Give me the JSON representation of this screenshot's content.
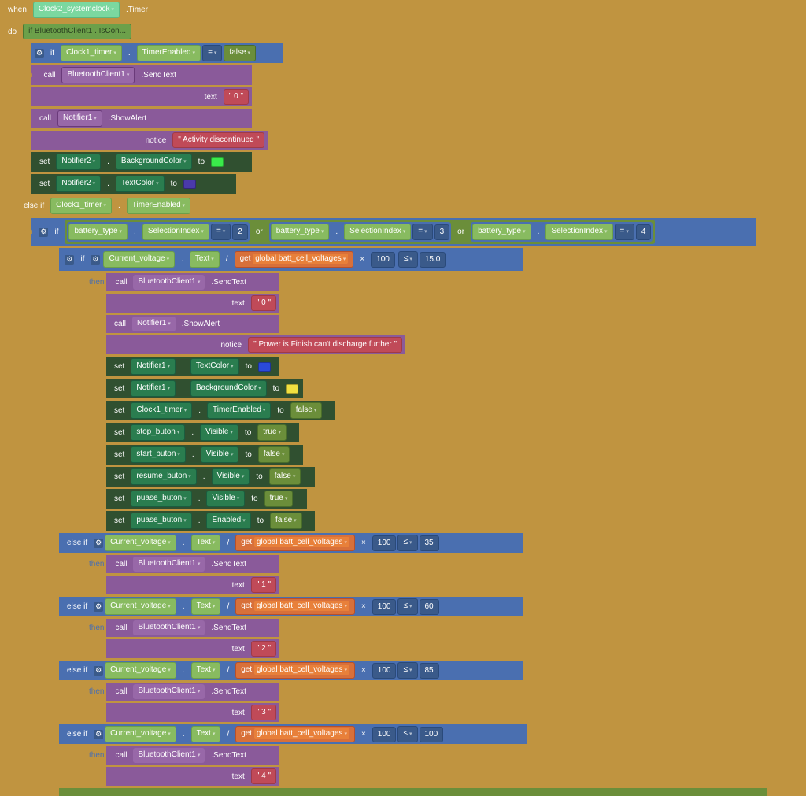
{
  "header": {
    "when": "when",
    "clock": "Clock2_systemclock",
    "timer": ".Timer"
  },
  "do": "do",
  "if_label": "if",
  "then_label": "then",
  "elseif_label": "else if",
  "cond_bt": "if BluetoothClient1 . IsCon...",
  "clock1_timer": "Clock1_timer",
  "timer_enabled": "TimerEnabled",
  "eq": "=",
  "false": "false",
  "true": "true",
  "call": "call",
  "bt_client": "BluetoothClient1",
  "send_text": ".SendText",
  "text_lbl": "text",
  "val_0": " 0 ",
  "val_1": " 1 ",
  "val_2": " 2 ",
  "val_3": " 3 ",
  "val_4": " 4 ",
  "notifier1": "Notifier1",
  "notifier2": "Notifier2",
  "show_alert": ".ShowAlert",
  "notice": "notice",
  "msg_discontinued": " Activity discontinued ",
  "msg_power_finish": " Power is Finish can't discharge further ",
  "set": "set",
  "bg_color": "BackgroundColor",
  "text_color": "TextColor",
  "to": "to",
  "battery_type": "battery_type",
  "selection_index": "SelectionIndex",
  "or": "or",
  "n2": "2",
  "n3": "3",
  "n4": "4",
  "current_voltage": "Current_voltage",
  "text_prop": "Text",
  "divide": "/",
  "get": "get",
  "global_bcv": "global batt_cell_voltages",
  "times": "×",
  "n100": "100",
  "le": "≤",
  "n15": "15.0",
  "n35": "35",
  "n60": "60",
  "n85": "85",
  "stop_buton": "stop_buton",
  "start_buton": "start_buton",
  "resume_buton": "resume_buton",
  "puase_buton": "puase_buton",
  "visible": "Visible",
  "enabled": "Enabled",
  "dot": "."
}
